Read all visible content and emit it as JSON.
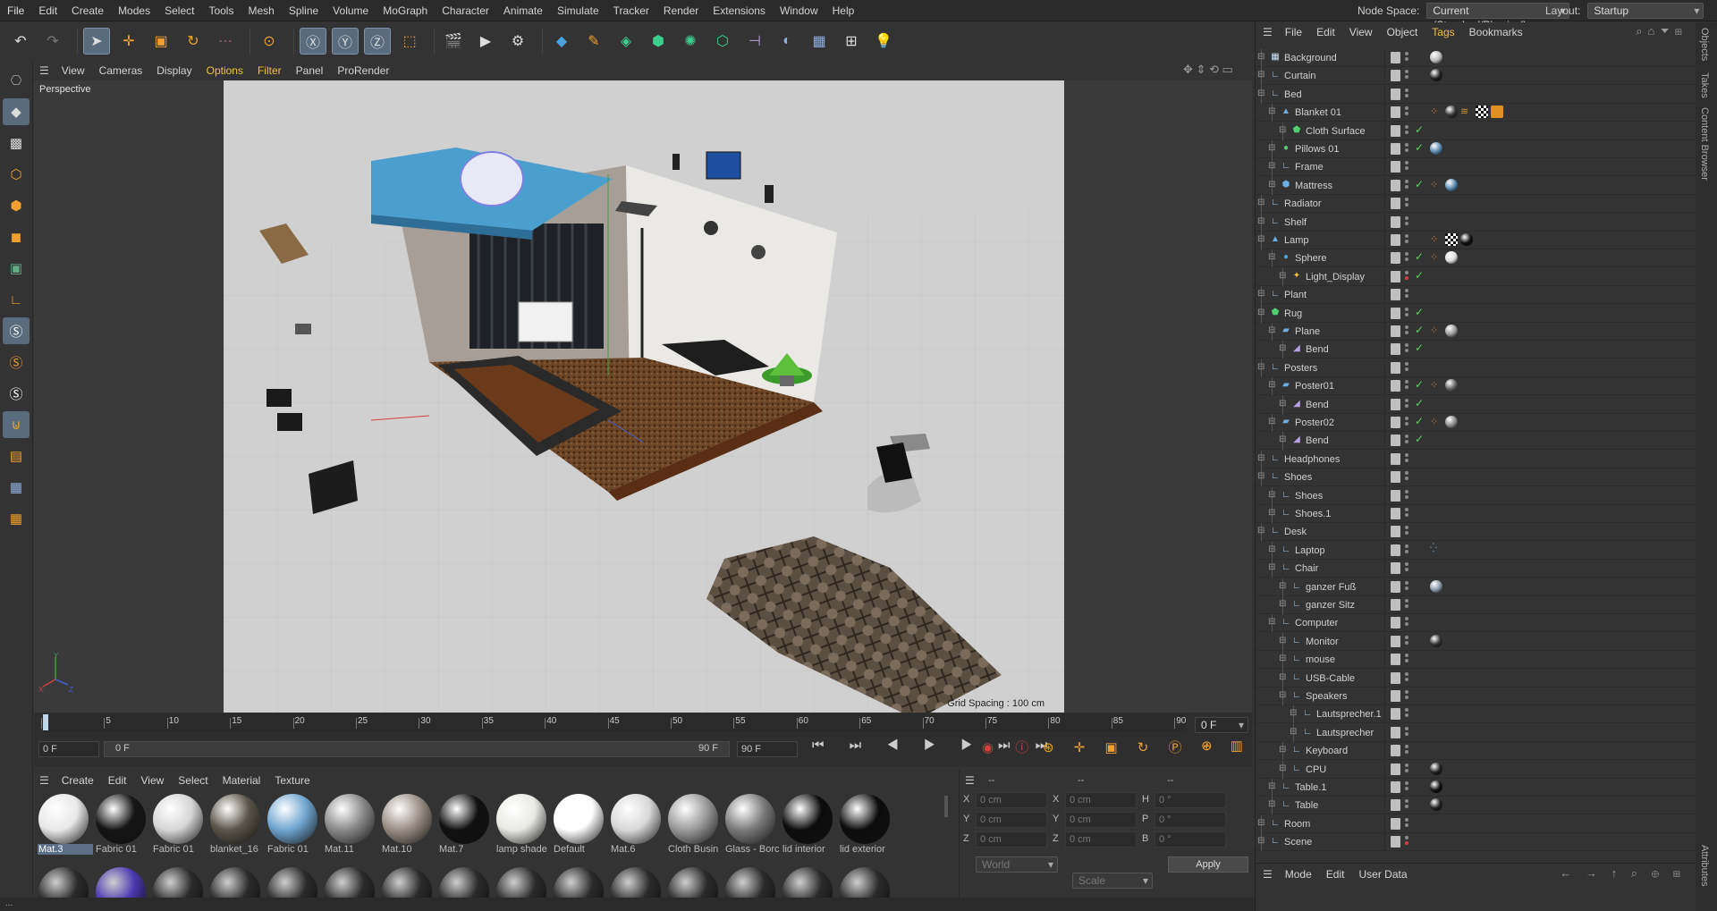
{
  "menu": [
    "File",
    "Edit",
    "Create",
    "Modes",
    "Select",
    "Tools",
    "Mesh",
    "Spline",
    "Volume",
    "MoGraph",
    "Character",
    "Animate",
    "Simulate",
    "Tracker",
    "Render",
    "Extensions",
    "Window",
    "Help"
  ],
  "node_space": {
    "label": "Node Space:",
    "value": "Current (Standard/Physical)"
  },
  "layout": {
    "label": "Layout:",
    "value": "Startup"
  },
  "viewport_menu": [
    "View",
    "Cameras",
    "Display",
    "Options",
    "Filter",
    "Panel",
    "ProRender"
  ],
  "viewport": {
    "name": "Perspective",
    "grid_spacing": "Grid Spacing : 100 cm"
  },
  "timeline": {
    "ticks": [
      "0",
      "5",
      "10",
      "15",
      "20",
      "25",
      "30",
      "35",
      "40",
      "45",
      "50",
      "55",
      "60",
      "65",
      "70",
      "75",
      "80",
      "85",
      "90"
    ],
    "current_frame": "0 F",
    "start_field": "0 F",
    "range_start": "0 F",
    "range_end": "90 F",
    "end_field": "90 F"
  },
  "material_menu": [
    "Create",
    "Edit",
    "View",
    "Select",
    "Material",
    "Texture"
  ],
  "materials": [
    {
      "name": "Mat.3",
      "color": "#e8e8e8",
      "selected": true
    },
    {
      "name": "Fabric 01",
      "color": "#151515"
    },
    {
      "name": "Fabric 01",
      "color": "#d6d6d6"
    },
    {
      "name": "blanket_16",
      "color": "#5a5448"
    },
    {
      "name": "Fabric 01",
      "color": "#6fa5d0"
    },
    {
      "name": "Mat.11",
      "color": "#8a8a8a"
    },
    {
      "name": "Mat.10",
      "color": "#9a8e84"
    },
    {
      "name": "Mat.7",
      "color": "#101010"
    },
    {
      "name": "lamp shade",
      "color": "#e9e9e4"
    },
    {
      "name": "Default",
      "color": "#ffffff"
    },
    {
      "name": "Mat.6",
      "color": "#d8d8d8"
    },
    {
      "name": "Cloth Busin",
      "color": "#9a9a9a"
    },
    {
      "name": "Glass - Borc",
      "color": "#7a7a7a"
    },
    {
      "name": "lid interior",
      "color": "#0c0c0c"
    },
    {
      "name": "lid exterior",
      "color": "#0c0c0c"
    }
  ],
  "coords": {
    "headers": [
      "--",
      "--",
      "--"
    ],
    "rows": [
      {
        "a": "X",
        "av": "0 cm",
        "b": "X",
        "bv": "0 cm",
        "c": "H",
        "cv": "0 °"
      },
      {
        "a": "Y",
        "av": "0 cm",
        "b": "Y",
        "bv": "0 cm",
        "c": "P",
        "cv": "0 °"
      },
      {
        "a": "Z",
        "av": "0 cm",
        "b": "Z",
        "bv": "0 cm",
        "c": "B",
        "cv": "0 °"
      }
    ],
    "world": "World",
    "scale": "Scale",
    "apply": "Apply"
  },
  "object_menu": [
    "File",
    "Edit",
    "View",
    "Object",
    "Tags",
    "Bookmarks"
  ],
  "objects": [
    {
      "name": "Background",
      "depth": 0,
      "icon": "bg"
    },
    {
      "name": "Curtain",
      "depth": 0,
      "icon": "null"
    },
    {
      "name": "Bed",
      "depth": 0,
      "icon": "null"
    },
    {
      "name": "Blanket 01",
      "depth": 1,
      "icon": "cloth"
    },
    {
      "name": "Cloth Surface",
      "depth": 2,
      "icon": "cloth-surface",
      "check": true
    },
    {
      "name": "Pillows 01",
      "depth": 1,
      "icon": "pillow",
      "check": true
    },
    {
      "name": "Frame",
      "depth": 1,
      "icon": "null"
    },
    {
      "name": "Mattress",
      "depth": 1,
      "icon": "mesh",
      "check": true
    },
    {
      "name": "Radiator",
      "depth": 0,
      "icon": "null"
    },
    {
      "name": "Shelf",
      "depth": 0,
      "icon": "null"
    },
    {
      "name": "Lamp",
      "depth": 0,
      "icon": "lamp"
    },
    {
      "name": "Sphere",
      "depth": 1,
      "icon": "sphere",
      "check": true
    },
    {
      "name": "Light_Display",
      "depth": 2,
      "icon": "light",
      "check": true
    },
    {
      "name": "Plant",
      "depth": 0,
      "icon": "null"
    },
    {
      "name": "Rug",
      "depth": 0,
      "icon": "rug",
      "check": true
    },
    {
      "name": "Plane",
      "depth": 1,
      "icon": "plane",
      "check": true
    },
    {
      "name": "Bend",
      "depth": 2,
      "icon": "bend",
      "check": true
    },
    {
      "name": "Posters",
      "depth": 0,
      "icon": "null"
    },
    {
      "name": "Poster01",
      "depth": 1,
      "icon": "plane",
      "check": true
    },
    {
      "name": "Bend",
      "depth": 2,
      "icon": "bend",
      "check": true
    },
    {
      "name": "Poster02",
      "depth": 1,
      "icon": "plane",
      "check": true
    },
    {
      "name": "Bend",
      "depth": 2,
      "icon": "bend",
      "check": true
    },
    {
      "name": "Headphones",
      "depth": 0,
      "icon": "null"
    },
    {
      "name": "Shoes",
      "depth": 0,
      "icon": "null"
    },
    {
      "name": "Shoes",
      "depth": 1,
      "icon": "null"
    },
    {
      "name": "Shoes.1",
      "depth": 1,
      "icon": "null"
    },
    {
      "name": "Desk",
      "depth": 0,
      "icon": "null"
    },
    {
      "name": "Laptop",
      "depth": 1,
      "icon": "null"
    },
    {
      "name": "Chair",
      "depth": 1,
      "icon": "null"
    },
    {
      "name": "ganzer Fuß",
      "depth": 2,
      "icon": "null"
    },
    {
      "name": "ganzer Sitz",
      "depth": 2,
      "icon": "null"
    },
    {
      "name": "Computer",
      "depth": 1,
      "icon": "null"
    },
    {
      "name": "Monitor",
      "depth": 2,
      "icon": "null"
    },
    {
      "name": "mouse",
      "depth": 2,
      "icon": "null"
    },
    {
      "name": "USB-Cable",
      "depth": 2,
      "icon": "null"
    },
    {
      "name": "Speakers",
      "depth": 2,
      "icon": "null"
    },
    {
      "name": "Lautsprecher.1",
      "depth": 3,
      "icon": "null"
    },
    {
      "name": "Lautsprecher",
      "depth": 3,
      "icon": "null"
    },
    {
      "name": "Keyboard",
      "depth": 2,
      "icon": "null"
    },
    {
      "name": "CPU",
      "depth": 2,
      "icon": "null"
    },
    {
      "name": "Table.1",
      "depth": 1,
      "icon": "null"
    },
    {
      "name": "Table",
      "depth": 1,
      "icon": "null"
    },
    {
      "name": "Room",
      "depth": 0,
      "icon": "null"
    },
    {
      "name": "Scene",
      "depth": 0,
      "icon": "null"
    }
  ],
  "attr_menu": [
    "Mode",
    "Edit",
    "User Data"
  ],
  "side_tabs": [
    "Objects",
    "Takes",
    "Content Browser",
    "Attributes"
  ],
  "status": "..."
}
